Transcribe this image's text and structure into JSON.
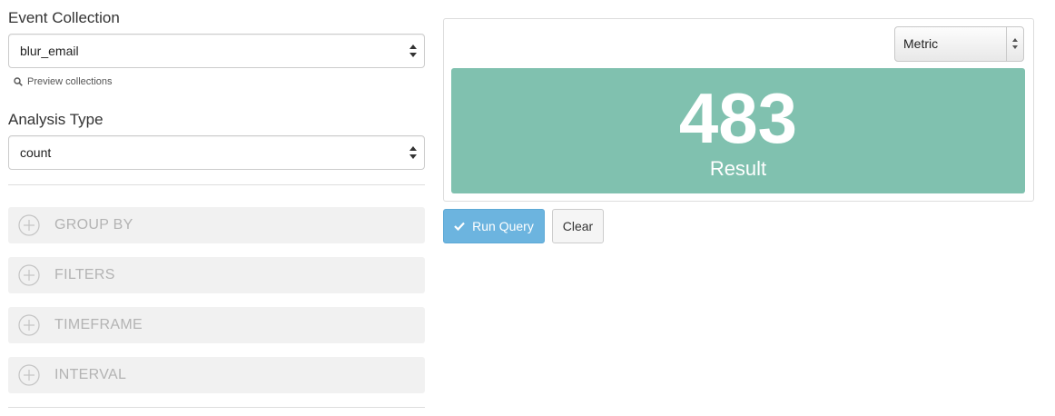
{
  "event_collection": {
    "label": "Event Collection",
    "value": "blur_email",
    "preview_link": "Preview collections"
  },
  "analysis_type": {
    "label": "Analysis Type",
    "value": "count"
  },
  "accordions": [
    {
      "label": "GROUP BY"
    },
    {
      "label": "FILTERS"
    },
    {
      "label": "TIMEFRAME"
    },
    {
      "label": "INTERVAL"
    }
  ],
  "visualization": {
    "type_value": "Metric",
    "result_value": "483",
    "result_label": "Result"
  },
  "actions": {
    "run_label": "Run Query",
    "clear_label": "Clear"
  },
  "colors": {
    "result_bg": "#80c1af",
    "run_button": "#6cb4df"
  }
}
